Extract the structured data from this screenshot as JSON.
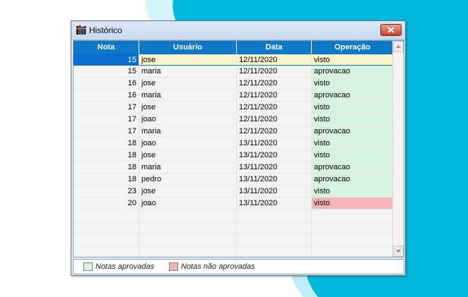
{
  "window": {
    "title": "Histórico"
  },
  "table": {
    "columns": [
      "Nota",
      "Usuário",
      "Data",
      "Operação"
    ],
    "rows": [
      {
        "nota": "15",
        "usuario": "jose",
        "data": "12/11/2020",
        "operacao": "visto",
        "status": "selected"
      },
      {
        "nota": "15",
        "usuario": "maria",
        "data": "12/11/2020",
        "operacao": "aprovacao",
        "status": "approved"
      },
      {
        "nota": "16",
        "usuario": "jose",
        "data": "12/11/2020",
        "operacao": "visto",
        "status": "approved"
      },
      {
        "nota": "16",
        "usuario": "maria",
        "data": "12/11/2020",
        "operacao": "aprovacao",
        "status": "approved"
      },
      {
        "nota": "17",
        "usuario": "jose",
        "data": "12/11/2020",
        "operacao": "visto",
        "status": "approved"
      },
      {
        "nota": "17",
        "usuario": "joao",
        "data": "12/11/2020",
        "operacao": "visto",
        "status": "approved"
      },
      {
        "nota": "17",
        "usuario": "maria",
        "data": "12/11/2020",
        "operacao": "aprovacao",
        "status": "approved"
      },
      {
        "nota": "18",
        "usuario": "joao",
        "data": "13/11/2020",
        "operacao": "visto",
        "status": "approved"
      },
      {
        "nota": "18",
        "usuario": "jose",
        "data": "13/11/2020",
        "operacao": "visto",
        "status": "approved"
      },
      {
        "nota": "18",
        "usuario": "maria",
        "data": "13/11/2020",
        "operacao": "aprovacao",
        "status": "approved"
      },
      {
        "nota": "18",
        "usuario": "pedro",
        "data": "13/11/2020",
        "operacao": "aprovacao",
        "status": "approved"
      },
      {
        "nota": "23",
        "usuario": "jose",
        "data": "13/11/2020",
        "operacao": "visto",
        "status": "approved"
      },
      {
        "nota": "20",
        "usuario": "joao",
        "data": "13/11/2020",
        "operacao": "visto",
        "status": "rejected"
      }
    ]
  },
  "legend": {
    "approved_label": "Notas aprovadas",
    "rejected_label": "Notas não aprovadas",
    "approved_color": "#d6f3e0",
    "rejected_color": "#f2b4b4"
  },
  "colors": {
    "header": "#0d79c7",
    "selection": "#0a6fd0",
    "selected_row": "#f9f3cc",
    "desktop_accent": "#00b4d8"
  }
}
